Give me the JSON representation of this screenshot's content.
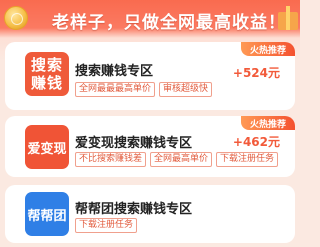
{
  "banner": {
    "title": "老样子，只做全网最高收益！！",
    "icons": [
      "coin-icon",
      "gift-icon"
    ]
  },
  "cards": [
    {
      "logo_lines": [
        "搜索",
        "赚钱"
      ],
      "title": "搜索赚钱专区",
      "tags": [
        "全网最最最高单价",
        "审核超级快"
      ],
      "badge": "火热推荐",
      "reward": "+524元"
    },
    {
      "logo": "爱变现",
      "title": "爱变现搜索赚钱专区",
      "tags": [
        "不比搜索赚钱差",
        "全网最高单价",
        "下载注册任务"
      ],
      "badge": "火热推荐",
      "reward": "+462元"
    },
    {
      "logo": "帮帮团",
      "title": "帮帮团搜索赚钱专区",
      "tags": [
        "下载注册任务"
      ]
    }
  ],
  "colors": {
    "accent": "#f25a3a",
    "blue_logo": "#2f7fe6"
  }
}
